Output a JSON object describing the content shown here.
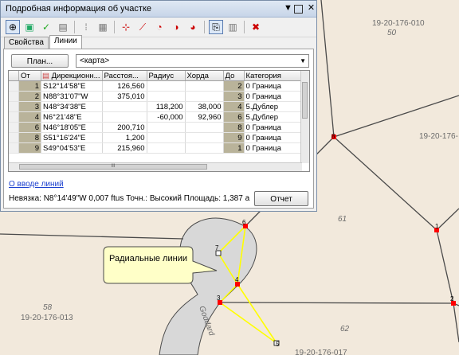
{
  "window": {
    "title": "Подробная информация об участке",
    "controls": [
      "pin-icon",
      "dock-icon",
      "close-icon"
    ]
  },
  "toolbar": {
    "tools": [
      "pan-to-point-icon",
      "add-parcel-icon",
      "check-icon",
      "table-icon",
      "grid-select-icon",
      "map-point-icon",
      "line-draw-icon",
      "curve-icon",
      "circle-icon",
      "curve-radial-icon",
      "fixed-line-icon",
      "copy-icon",
      "delete-icon"
    ]
  },
  "tabs": [
    "Свойства",
    "Линии"
  ],
  "panel": {
    "plan_button": "План...",
    "plan_combo": "<карта>",
    "columns": [
      "От",
      "Дирекционн...",
      "Расстоя...",
      "Радиус",
      "Хорда",
      "До",
      "Категория"
    ],
    "rows": [
      [
        "1",
        "S12°14'58\"E",
        "126,560",
        "",
        "",
        "2",
        "0 Граница"
      ],
      [
        "2",
        "N88°31'07\"W",
        "375,010",
        "",
        "",
        "3",
        "0 Граница"
      ],
      [
        "3",
        "N48°34'38\"E",
        "",
        "118,200",
        "38,000",
        "4",
        "5.Дублер"
      ],
      [
        "4",
        "N6°21'48\"E",
        "",
        "-60,000",
        "92,960",
        "6",
        "5.Дублер"
      ],
      [
        "6",
        "N46°18'05\"E",
        "200,710",
        "",
        "",
        "8",
        "0 Граница"
      ],
      [
        "8",
        "S51°16'24\"E",
        "1,200",
        "",
        "",
        "9",
        "0 Граница"
      ],
      [
        "9",
        "S49°04'53\"E",
        "215,960",
        "",
        "",
        "1",
        "0 Граница"
      ]
    ],
    "link": "О вводе линий",
    "status": "Невязка: N8°14'49\"W 0,007 ftus  Точн.: Высокий  Площадь: 1,387 a",
    "report_button": "Отчет",
    "hscroll_grip": "III"
  },
  "map": {
    "labels": {
      "parcel_top_right": "19-20-176-010",
      "parcel_top_right_num": "50",
      "parcel_right": "19-20-176-",
      "parcel_61": "61",
      "parcel_58": "58",
      "parcel_bottom_left": "19-20-176-013",
      "parcel_62": "62",
      "parcel_bottom": "19-20-176-017",
      "street": "Goddard"
    },
    "points": [
      "8",
      "1",
      "6",
      "7",
      "4",
      "3",
      "5",
      "2"
    ],
    "callout": "Радиальные линии",
    "colors": {
      "parcel_fill": "#f2e9dc",
      "road_fill": "#d8d8d8",
      "boundary": "#4a4a4a",
      "radial": "#ffff00",
      "point": "#ff0000",
      "callout_fill": "#ffffc8"
    }
  }
}
